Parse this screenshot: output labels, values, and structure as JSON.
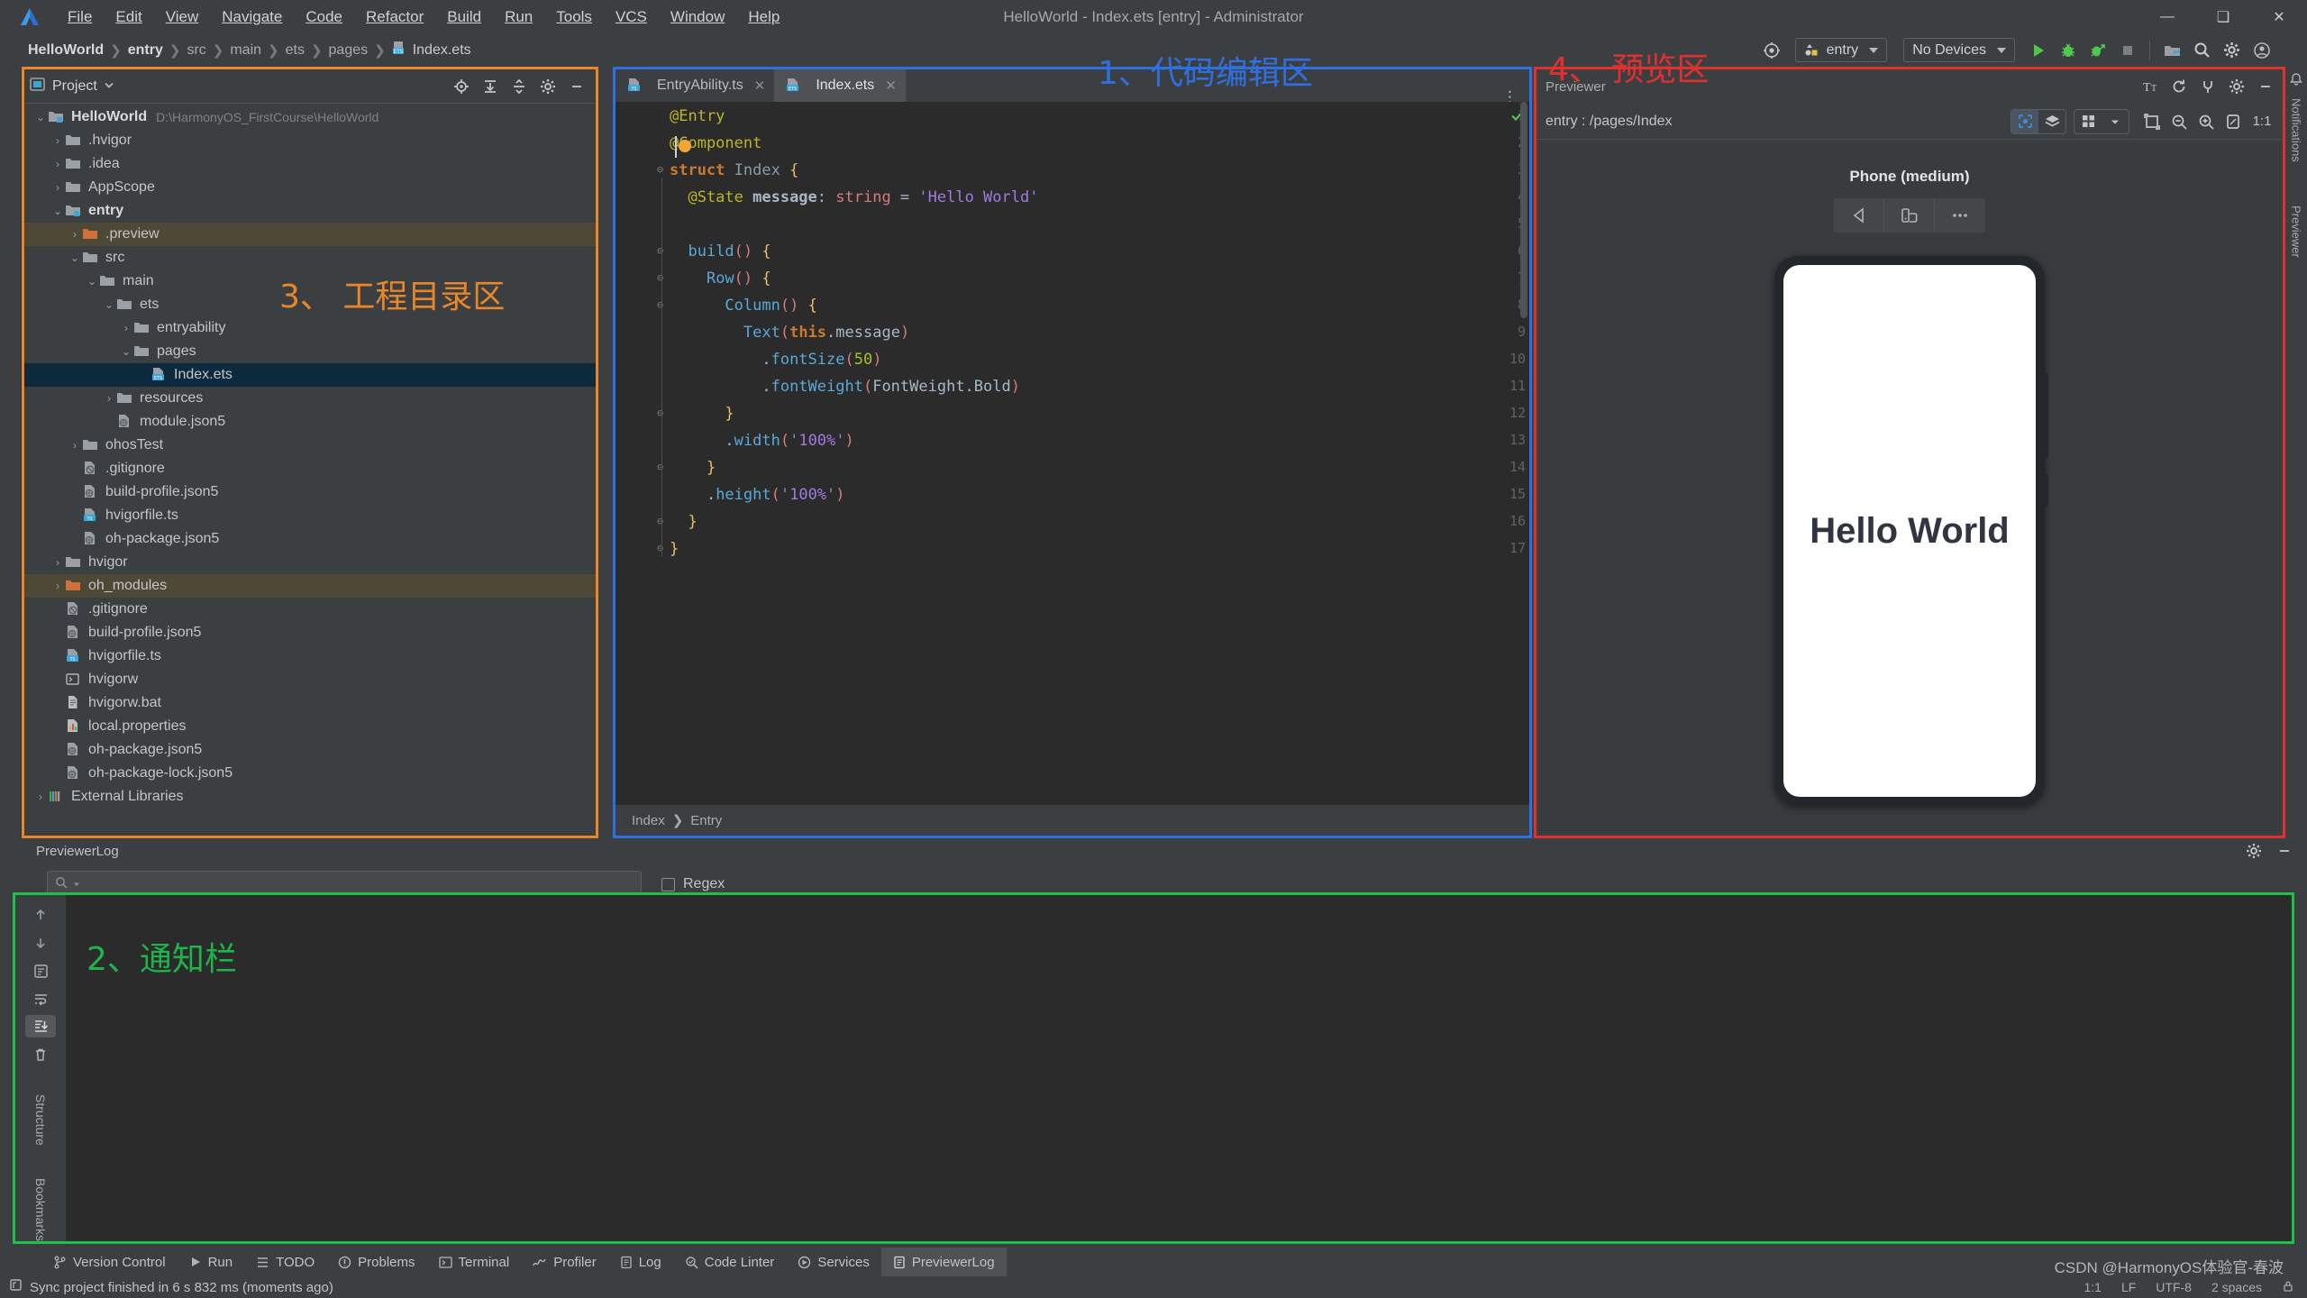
{
  "window": {
    "title": "HelloWorld - Index.ets [entry] - Administrator",
    "logo_icon": "deveco-studio-logo-icon",
    "minimize": "—",
    "maximize": "❑",
    "close": "✕"
  },
  "menubar": {
    "items": [
      "File",
      "Edit",
      "View",
      "Navigate",
      "Code",
      "Refactor",
      "Build",
      "Run",
      "Tools",
      "VCS",
      "Window",
      "Help"
    ]
  },
  "toolbar": {
    "breadcrumbs": [
      "HelloWorld",
      "entry",
      "src",
      "main",
      "ets",
      "pages"
    ],
    "breadcrumb_file": "Index.ets",
    "target_icon": "device-manager-icon",
    "run_config": "entry",
    "device_select": "No Devices",
    "run_icon": "run-icon",
    "debug_icon": "debug-icon",
    "attach_icon": "attach-debugger-icon",
    "stop_icon": "stop-icon",
    "project_structure_icon": "project-structure-icon",
    "search_icon": "search-everywhere-icon",
    "settings_icon": "gear-icon",
    "account_icon": "account-avatar-icon"
  },
  "project_panel": {
    "title": "Project",
    "dropdown_icon": "chevron-down-icon",
    "actions": [
      "locate-icon",
      "expand-all-icon",
      "collapse-all-icon",
      "gear-icon",
      "hide-icon"
    ],
    "tree": [
      {
        "depth": 0,
        "arrow": "⌄",
        "icon": "module-folder-icon",
        "label": "HelloWorld",
        "bold": true,
        "path": "D:\\HarmonyOS_FirstCourse\\HelloWorld",
        "state": "normal"
      },
      {
        "depth": 1,
        "arrow": "›",
        "icon": "folder-icon",
        "label": ".hvigor",
        "state": "normal"
      },
      {
        "depth": 1,
        "arrow": "›",
        "icon": "folder-icon",
        "label": ".idea",
        "state": "normal"
      },
      {
        "depth": 1,
        "arrow": "›",
        "icon": "folder-icon",
        "label": "AppScope",
        "state": "normal"
      },
      {
        "depth": 1,
        "arrow": "⌄",
        "icon": "module-folder-icon",
        "label": "entry",
        "bold": true,
        "state": "normal"
      },
      {
        "depth": 2,
        "arrow": "›",
        "icon": "orange-folder-icon",
        "label": ".preview",
        "state": "highlight"
      },
      {
        "depth": 2,
        "arrow": "⌄",
        "icon": "folder-icon",
        "label": "src",
        "state": "normal"
      },
      {
        "depth": 3,
        "arrow": "⌄",
        "icon": "folder-icon",
        "label": "main",
        "state": "normal"
      },
      {
        "depth": 4,
        "arrow": "⌄",
        "icon": "folder-icon",
        "label": "ets",
        "state": "normal"
      },
      {
        "depth": 5,
        "arrow": "›",
        "icon": "folder-icon",
        "label": "entryability",
        "state": "normal"
      },
      {
        "depth": 5,
        "arrow": "⌄",
        "icon": "folder-icon",
        "label": "pages",
        "state": "normal"
      },
      {
        "depth": 6,
        "arrow": "",
        "icon": "ets-file-icon",
        "label": "Index.ets",
        "state": "selected"
      },
      {
        "depth": 4,
        "arrow": "›",
        "icon": "folder-icon",
        "label": "resources",
        "state": "normal"
      },
      {
        "depth": 4,
        "arrow": "",
        "icon": "json5-file-icon",
        "label": "module.json5",
        "state": "normal"
      },
      {
        "depth": 2,
        "arrow": "›",
        "icon": "folder-icon",
        "label": "ohosTest",
        "state": "normal"
      },
      {
        "depth": 2,
        "arrow": "",
        "icon": "gitignore-file-icon",
        "label": ".gitignore",
        "state": "normal"
      },
      {
        "depth": 2,
        "arrow": "",
        "icon": "json5-file-icon",
        "label": "build-profile.json5",
        "state": "normal"
      },
      {
        "depth": 2,
        "arrow": "",
        "icon": "ts-file-icon",
        "label": "hvigorfile.ts",
        "state": "normal"
      },
      {
        "depth": 2,
        "arrow": "",
        "icon": "json5-file-icon",
        "label": "oh-package.json5",
        "state": "normal"
      },
      {
        "depth": 1,
        "arrow": "›",
        "icon": "folder-icon",
        "label": "hvigor",
        "state": "normal"
      },
      {
        "depth": 1,
        "arrow": "›",
        "icon": "orange-folder-icon",
        "label": "oh_modules",
        "state": "highlight"
      },
      {
        "depth": 1,
        "arrow": "",
        "icon": "gitignore-file-icon",
        "label": ".gitignore",
        "state": "normal"
      },
      {
        "depth": 1,
        "arrow": "",
        "icon": "json5-file-icon",
        "label": "build-profile.json5",
        "state": "normal"
      },
      {
        "depth": 1,
        "arrow": "",
        "icon": "ts-file-icon",
        "label": "hvigorfile.ts",
        "state": "normal"
      },
      {
        "depth": 1,
        "arrow": "",
        "icon": "shell-file-icon",
        "label": "hvigorw",
        "state": "normal"
      },
      {
        "depth": 1,
        "arrow": "",
        "icon": "bat-file-icon",
        "label": "hvigorw.bat",
        "state": "normal"
      },
      {
        "depth": 1,
        "arrow": "",
        "icon": "properties-file-icon",
        "label": "local.properties",
        "state": "normal"
      },
      {
        "depth": 1,
        "arrow": "",
        "icon": "json5-file-icon",
        "label": "oh-package.json5",
        "state": "normal"
      },
      {
        "depth": 1,
        "arrow": "",
        "icon": "json5-file-icon",
        "label": "oh-package-lock.json5",
        "state": "normal"
      },
      {
        "depth": 0,
        "arrow": "›",
        "icon": "external-libraries-icon",
        "label": "External Libraries",
        "state": "normal"
      }
    ]
  },
  "editor": {
    "tabs": [
      {
        "label": "EntryAbility.ts",
        "icon": "ts-file-icon",
        "active": false,
        "close": "✕"
      },
      {
        "label": "Index.ets",
        "icon": "ets-file-icon",
        "active": true,
        "close": "✕"
      }
    ],
    "more_icon": "editor-options-icon",
    "inspection_ok_icon": "inspection-ok-icon",
    "code_lines": [
      {
        "n": "1",
        "fold": "",
        "tokens": [
          {
            "t": "@Entry",
            "c": "k-dec"
          }
        ]
      },
      {
        "n": "2",
        "fold": "",
        "tokens": [
          {
            "t": "@Component",
            "c": "k-dec"
          }
        ]
      },
      {
        "n": "3",
        "fold": "⊖",
        "tokens": [
          {
            "t": "struct ",
            "c": "k-kw k-bold"
          },
          {
            "t": "Index",
            "c": "k-type"
          },
          {
            "t": " {",
            "c": "k-br"
          }
        ]
      },
      {
        "n": "4",
        "fold": "",
        "tokens": [
          {
            "t": "  @State ",
            "c": "k-dec"
          },
          {
            "t": "message",
            "c": "k-id k-bold"
          },
          {
            "t": ": ",
            "c": "k-id"
          },
          {
            "t": "string",
            "c": "k-par"
          },
          {
            "t": " = ",
            "c": "k-id"
          },
          {
            "t": "'Hello World'",
            "c": "k-str"
          }
        ]
      },
      {
        "n": "5",
        "fold": "",
        "tokens": []
      },
      {
        "n": "6",
        "fold": "⊖",
        "tokens": [
          {
            "t": "  ",
            "c": "k-id"
          },
          {
            "t": "build",
            "c": "k-blue"
          },
          {
            "t": "()",
            "c": "k-par"
          },
          {
            "t": " {",
            "c": "k-br"
          }
        ]
      },
      {
        "n": "7",
        "fold": "⊖",
        "tokens": [
          {
            "t": "    ",
            "c": "k-id"
          },
          {
            "t": "Row",
            "c": "k-blue"
          },
          {
            "t": "()",
            "c": "k-par"
          },
          {
            "t": " {",
            "c": "k-br"
          }
        ]
      },
      {
        "n": "8",
        "fold": "⊖",
        "tokens": [
          {
            "t": "      ",
            "c": "k-id"
          },
          {
            "t": "Column",
            "c": "k-blue"
          },
          {
            "t": "()",
            "c": "k-par"
          },
          {
            "t": " {",
            "c": "k-br"
          }
        ]
      },
      {
        "n": "9",
        "fold": "",
        "tokens": [
          {
            "t": "        ",
            "c": "k-id"
          },
          {
            "t": "Text",
            "c": "k-blue"
          },
          {
            "t": "(",
            "c": "k-par"
          },
          {
            "t": "this",
            "c": "k-kw k-bold"
          },
          {
            "t": ".message",
            "c": "k-id"
          },
          {
            "t": ")",
            "c": "k-par"
          }
        ]
      },
      {
        "n": "10",
        "fold": "",
        "tokens": [
          {
            "t": "          .",
            "c": "k-id"
          },
          {
            "t": "fontSize",
            "c": "k-blue"
          },
          {
            "t": "(",
            "c": "k-par"
          },
          {
            "t": "50",
            "c": "k-num"
          },
          {
            "t": ")",
            "c": "k-par"
          }
        ]
      },
      {
        "n": "11",
        "fold": "",
        "tokens": [
          {
            "t": "          .",
            "c": "k-id"
          },
          {
            "t": "fontWeight",
            "c": "k-blue"
          },
          {
            "t": "(",
            "c": "k-par"
          },
          {
            "t": "FontWeight.Bold",
            "c": "k-id"
          },
          {
            "t": ")",
            "c": "k-par"
          }
        ]
      },
      {
        "n": "12",
        "fold": "⊖",
        "tokens": [
          {
            "t": "      }",
            "c": "k-br"
          }
        ]
      },
      {
        "n": "13",
        "fold": "",
        "tokens": [
          {
            "t": "      .",
            "c": "k-id"
          },
          {
            "t": "width",
            "c": "k-blue"
          },
          {
            "t": "(",
            "c": "k-par"
          },
          {
            "t": "'100%'",
            "c": "k-str"
          },
          {
            "t": ")",
            "c": "k-par"
          }
        ]
      },
      {
        "n": "14",
        "fold": "⊖",
        "tokens": [
          {
            "t": "    }",
            "c": "k-br"
          }
        ]
      },
      {
        "n": "15",
        "fold": "",
        "tokens": [
          {
            "t": "    .",
            "c": "k-id"
          },
          {
            "t": "height",
            "c": "k-blue"
          },
          {
            "t": "(",
            "c": "k-par"
          },
          {
            "t": "'100%'",
            "c": "k-str"
          },
          {
            "t": ")",
            "c": "k-par"
          }
        ]
      },
      {
        "n": "16",
        "fold": "⊖",
        "tokens": [
          {
            "t": "  }",
            "c": "k-br"
          }
        ]
      },
      {
        "n": "17",
        "fold": "⊖",
        "tokens": [
          {
            "t": "}",
            "c": "k-br"
          }
        ]
      }
    ],
    "bottom_breadcrumb": [
      "Index",
      "Entry"
    ]
  },
  "previewer": {
    "title": "Previewer",
    "actions": [
      "font-size-icon",
      "refresh-icon",
      "plug-icon",
      "gear-icon",
      "hide-icon"
    ],
    "route": "entry : /pages/Index",
    "inspector_icon": "inspector-icon",
    "layers_icon": "layers-icon",
    "multiprofile_icon": "multi-device-icon",
    "multiprofile_arrow": "chevron-down-icon",
    "rotate_icon": "rotate-icon",
    "zoom_out_icon": "zoom-out-icon",
    "zoom_in_icon": "zoom-in-icon",
    "fit_icon": "fit-to-screen-icon",
    "actual_size_label": "1:1",
    "device_name": "Phone (medium)",
    "device_buttons": [
      "back-icon",
      "rotate-device-icon",
      "more-icon"
    ],
    "screen_text": "Hello World"
  },
  "bottom_panel": {
    "title": "PreviewerLog",
    "search_placeholder": "",
    "search_icon": "search-icon",
    "search_dropdown_icon": "chevron-down-icon",
    "regex_label": "Regex",
    "settings_icon": "gear-icon",
    "hide_icon": "hide-icon",
    "side_icons": [
      "scroll-up-icon",
      "scroll-down-icon",
      "soft-wrap-icon",
      "wrap-icon",
      "scroll-to-end-icon",
      "trash-icon"
    ]
  },
  "tool_windows": [
    {
      "label": "Version Control",
      "icon": "branch-icon",
      "active": false
    },
    {
      "label": "Run",
      "icon": "run-icon",
      "active": false
    },
    {
      "label": "TODO",
      "icon": "todo-icon",
      "active": false
    },
    {
      "label": "Problems",
      "icon": "problems-icon",
      "active": false
    },
    {
      "label": "Terminal",
      "icon": "terminal-icon",
      "active": false
    },
    {
      "label": "Profiler",
      "icon": "profiler-icon",
      "active": false
    },
    {
      "label": "Log",
      "icon": "log-icon",
      "active": false
    },
    {
      "label": "Code Linter",
      "icon": "code-linter-icon",
      "active": false
    },
    {
      "label": "Services",
      "icon": "services-icon",
      "active": false
    },
    {
      "label": "PreviewerLog",
      "icon": "previewer-log-icon",
      "active": true
    }
  ],
  "left_strip": {
    "labels": [
      "Structure",
      "Bookmarks"
    ]
  },
  "right_strip": {
    "labels": [
      "Notifications",
      "Previewer"
    ]
  },
  "statusbar": {
    "icon": "status-event-icon",
    "text": "Sync project finished in 6 s 832 ms (moments ago)",
    "caret": "1:1",
    "line_sep": "LF",
    "encoding": "UTF-8",
    "indent": "2 spaces"
  },
  "annotations": [
    {
      "id": "anno1",
      "text": "1、代码编辑区",
      "color": "#2f6fe0"
    },
    {
      "id": "anno2",
      "text": "2、通知栏",
      "color": "#1fb44a"
    },
    {
      "id": "anno3",
      "text": "3、 工程目录区",
      "color": "#e8862a"
    },
    {
      "id": "anno4",
      "text": "4、 预览区",
      "color": "#e03030"
    }
  ],
  "watermark": "CSDN @HarmonyOS体验官-春波"
}
